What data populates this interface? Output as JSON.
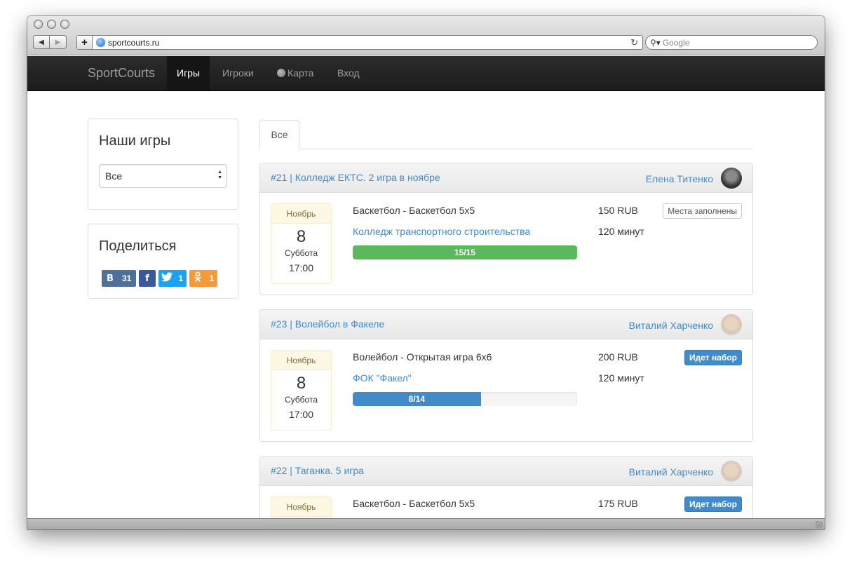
{
  "browser": {
    "url": "sportcourts.ru",
    "search_placeholder": "Google"
  },
  "navbar": {
    "brand": "SportCourts",
    "items": [
      {
        "label": "Игры",
        "active": true
      },
      {
        "label": "Игроки",
        "active": false
      },
      {
        "label": "Карта",
        "icon": "globe-icon",
        "active": false
      },
      {
        "label": "Вход",
        "active": false
      }
    ]
  },
  "sidebar": {
    "games_panel": {
      "title": "Наши игры",
      "select_value": "Все"
    },
    "share_panel": {
      "title": "Поделиться",
      "buttons": [
        {
          "network": "vk",
          "icon": "В",
          "count": "31",
          "color": "#4d7198"
        },
        {
          "network": "facebook",
          "icon": "f",
          "count": "",
          "color": "#3b5998"
        },
        {
          "network": "twitter",
          "icon": "twitter-bird-icon",
          "count": "1",
          "color": "#1da1f2"
        },
        {
          "network": "odnoklassniki",
          "icon": "ok-icon",
          "count": "1",
          "color": "#f59a3a"
        }
      ]
    }
  },
  "tabs": [
    {
      "label": "Все",
      "active": true
    }
  ],
  "games": [
    {
      "title": "#21 | Колледж ЕКТС. 2 игра в ноябре",
      "author": "Елена Титенко",
      "month": "Ноябрь",
      "day": "8",
      "weekday": "Суббота",
      "time": "17:00",
      "sport": "Баскетбол - Баскетбол 5х5",
      "venue": "Колледж транспортного строительства",
      "price": "150 RUB",
      "duration": "120 минут",
      "status": "Места заполнены",
      "progress_label": "15/15",
      "progress_fraction": 1.0,
      "progress_color": "#5cb85c"
    },
    {
      "title": "#23 | Волейбол в Факеле",
      "author": "Виталий Харченко",
      "month": "Ноябрь",
      "day": "8",
      "weekday": "Суббота",
      "time": "17:00",
      "sport": "Волейбол - Открытая игра 6х6",
      "venue": "ФОК \"Факел\"",
      "price": "200 RUB",
      "duration": "120 минут",
      "status": "Идет набор",
      "progress_label": "8/14",
      "progress_fraction": 0.571,
      "progress_color": "#428bca"
    },
    {
      "title": "#22 | Таганка. 5 игра",
      "author": "Виталий Харченко",
      "month": "Ноябрь",
      "sport": "Баскетбол - Баскетбол 5х5",
      "price": "175 RUB",
      "status": "Идет набор"
    }
  ]
}
